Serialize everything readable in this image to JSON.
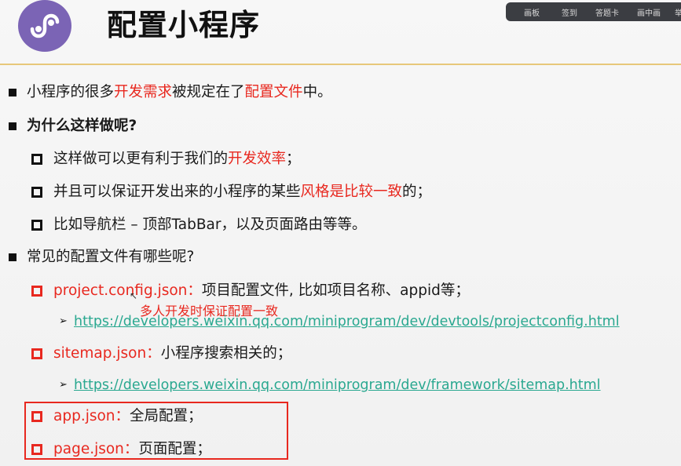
{
  "header": {
    "title": "配置小程序"
  },
  "toolbar": {
    "items": [
      "画板",
      "签到",
      "答题卡",
      "画中画",
      "举手"
    ]
  },
  "bullets": {
    "b1": {
      "parts": [
        "小程序的很多",
        "开发需求",
        "被规定在了",
        "配置文件",
        "中。"
      ]
    },
    "b2": {
      "text": "为什么这样做呢?",
      "subs": {
        "s1": [
          "这样做可以更有利于我们的",
          "开发效率",
          "；"
        ],
        "s2": [
          "并且可以保证开发出来的小程序的某些",
          "风格是比较一致",
          "的；"
        ],
        "s3": "比如导航栏 – 顶部TabBar，以及页面路由等等。"
      }
    },
    "b3": {
      "text": "常见的配置文件有哪些呢?",
      "items": {
        "project": {
          "name": "project.config.json：",
          "desc": "项目配置文件, 比如项目名称、appid等；",
          "annotation": "多人开发时保证配置一致",
          "link": "https://developers.weixin.qq.com/miniprogram/dev/devtools/projectconfig.html"
        },
        "sitemap": {
          "name": "sitemap.json：",
          "desc": "小程序搜索相关的；",
          "link": "https://developers.weixin.qq.com/miniprogram/dev/framework/sitemap.html"
        },
        "app": {
          "name": "app.json：",
          "desc": "全局配置；"
        },
        "page": {
          "name": "page.json：",
          "desc": "页面配置；"
        }
      }
    }
  },
  "colors": {
    "accent_red": "#e8281f",
    "link_green": "#2aa890",
    "logo_purple": "#7b64b5",
    "rule_gold": "#e7c77a"
  },
  "icons": {
    "logo": "mini-program-logo-icon",
    "square": "square-bullet-icon",
    "hollow": "hollow-square-bullet-icon",
    "arrow": "arrow-bullet-icon"
  }
}
